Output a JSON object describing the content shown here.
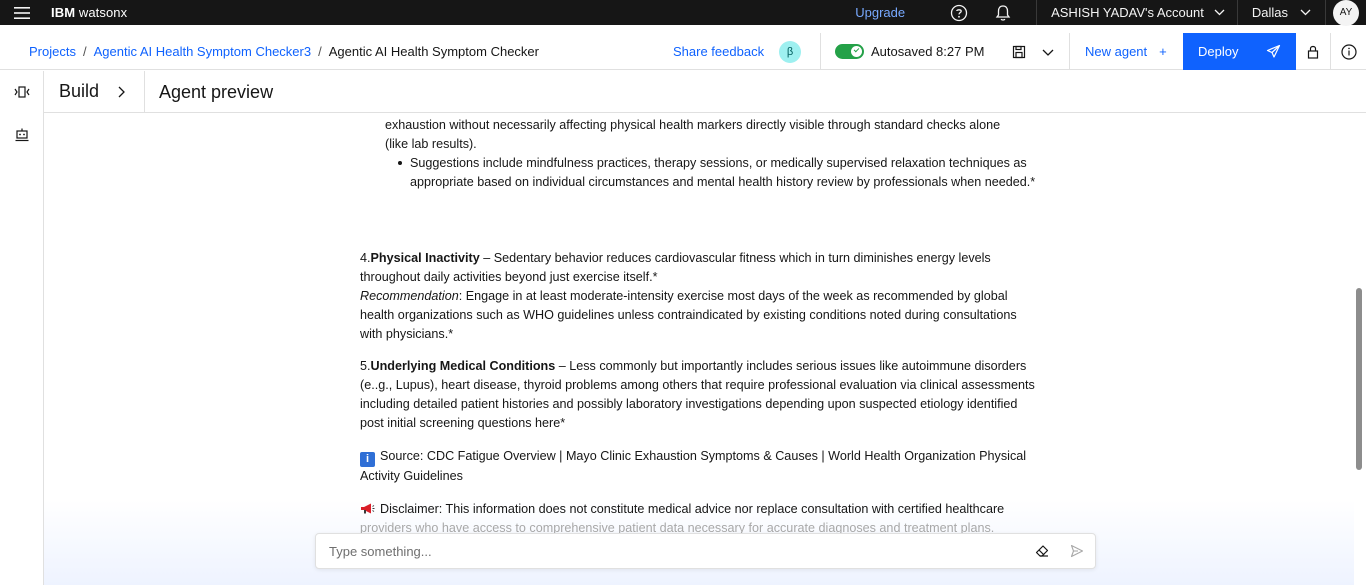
{
  "topbar": {
    "brand_bold": "IBM ",
    "brand_light": "watsonx",
    "upgrade": "Upgrade",
    "account": "ASHISH YADAV's Account",
    "region": "Dallas",
    "avatar": "AY"
  },
  "breadcrumb": {
    "projects": "Projects",
    "sep": "/",
    "project": "Agentic AI Health Symptom Checker3",
    "current": "Agentic AI Health Symptom Checker"
  },
  "toolbar": {
    "feedback": "Share feedback",
    "beta": "β",
    "autosaved": "Autosaved 8:27 PM",
    "new_agent": "New agent",
    "new_agent_plus": "+",
    "deploy": "Deploy"
  },
  "section": {
    "build": "Build",
    "preview": "Agent preview"
  },
  "message": {
    "line_top_partial": "exhaustion without necessarily affecting physical health markers directly visible through standard checks alone",
    "line_lab": "(like lab results).",
    "bullet_suggestions": "Suggestions include mindfulness practices, therapy sessions, or medically supervised relaxation techniques as appropriate based on individual circumstances and mental health history review by professionals when needed.*",
    "p4_num": "4.",
    "p4_title": "Physical Inactivity",
    "p4_body": " – Sedentary behavior reduces cardiovascular fitness which in turn diminishes energy levels throughout daily activities beyond just exercise itself.*",
    "p4_rec_label": "Recommendation",
    "p4_rec_body": ": Engage in at least moderate-intensity exercise most days of the week as recommended by global health organizations such as WHO guidelines unless contraindicated by existing conditions noted during consultations with physicians.*",
    "p5_num": "5.",
    "p5_title": "Underlying Medical Conditions",
    "p5_body": " – Less commonly but importantly includes serious issues like autoimmune disorders (e..g., Lupus), heart disease, thyroid problems among others that require professional evaluation via clinical assessments including detailed patient histories and possibly laboratory investigations depending upon suspected etiology identified post initial screening questions here*",
    "source_icon": "i",
    "source": "Source: CDC Fatigue Overview | Mayo Clinic Exhaustion Symptoms & Causes | World Health Organization Physical Activity Guidelines",
    "disclaimer": "Disclaimer: This information does not constitute medical advice nor replace consultation with certified healthcare",
    "disclaimer_faded": "providers who have access to comprehensive patient data necessary for accurate diagnoses and treatment plans."
  },
  "input": {
    "placeholder": "Type something..."
  },
  "colors": {
    "primary": "#0f62fe",
    "topbar": "#161616",
    "toggle_on": "#24a148",
    "beta_bg": "#9ef0f0"
  }
}
